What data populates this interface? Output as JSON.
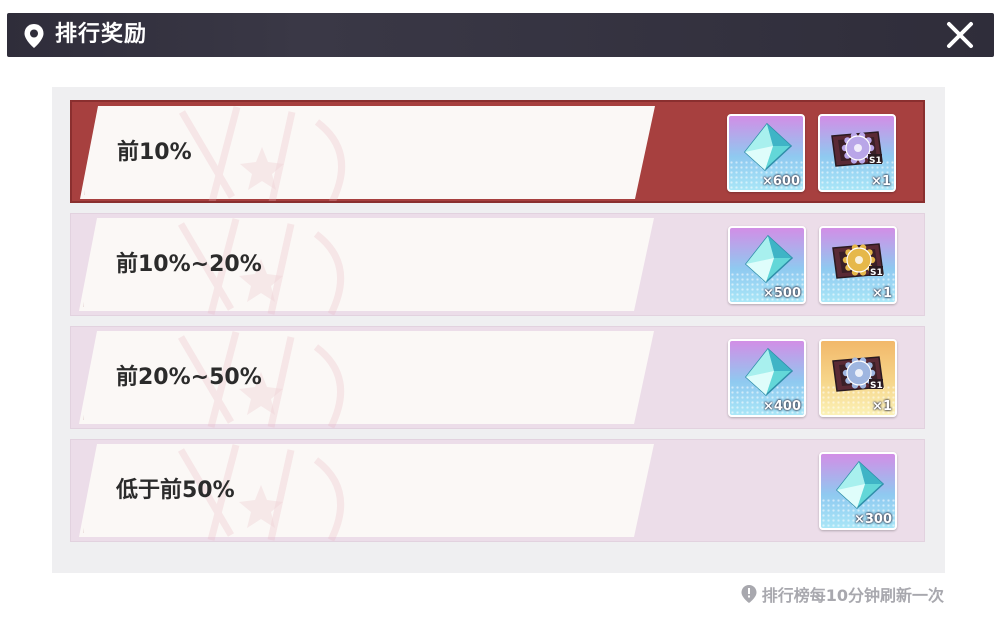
{
  "header": {
    "title": "排行奖励",
    "icons": {
      "location": "location-pin-icon",
      "close": "close-icon"
    }
  },
  "rows": [
    {
      "label": "前10%",
      "highlighted": true,
      "rewards": [
        {
          "icon": "diamond-crystal-icon",
          "quantity": "×600",
          "frame": "purple"
        },
        {
          "icon": "gear-badge-ticket-icon",
          "quantity": "×1",
          "frame": "purple",
          "gear_color": "#b9a6e8"
        }
      ]
    },
    {
      "label": "前10%~20%",
      "highlighted": false,
      "rewards": [
        {
          "icon": "diamond-crystal-icon",
          "quantity": "×500",
          "frame": "purple"
        },
        {
          "icon": "gear-badge-ticket-icon",
          "quantity": "×1",
          "frame": "purple",
          "gear_color": "#e6b84a"
        }
      ]
    },
    {
      "label": "前20%~50%",
      "highlighted": false,
      "rewards": [
        {
          "icon": "diamond-crystal-icon",
          "quantity": "×400",
          "frame": "purple"
        },
        {
          "icon": "gear-badge-ticket-icon",
          "quantity": "×1",
          "frame": "gold",
          "gear_color": "#9fb6e0"
        }
      ]
    },
    {
      "label": "低于前50%",
      "highlighted": false,
      "rewards": [
        {
          "icon": "diamond-crystal-icon",
          "quantity": "×300",
          "frame": "purple"
        }
      ]
    }
  ],
  "footer": {
    "note": "排行榜每10分钟刷新一次",
    "icon": "info-pin-icon"
  },
  "colors": {
    "titlebar": "#2f2d3a",
    "highlight_row": "#a7403f",
    "normal_row": "#ecdde9",
    "panel": "#efeff1"
  }
}
